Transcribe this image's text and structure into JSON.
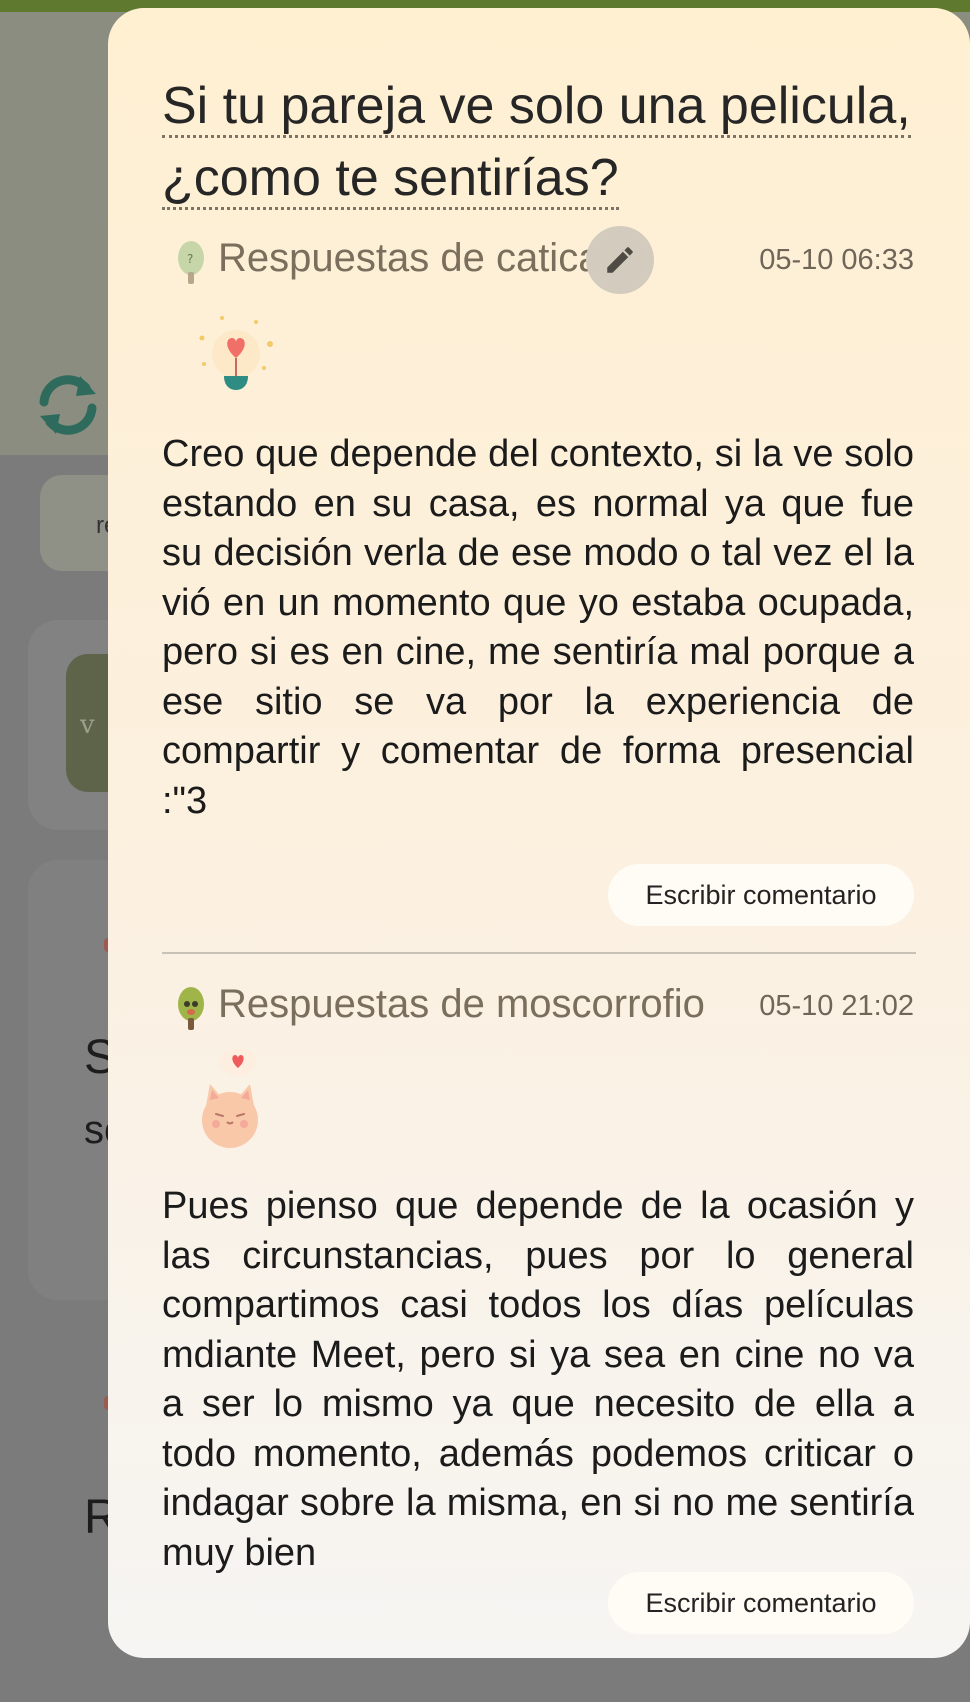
{
  "background": {
    "card_fragment": "re",
    "card_fragment2": "v",
    "letters": [
      "S",
      "so",
      "R"
    ]
  },
  "question": {
    "title_line1": "Si tu pareja ve solo una pelicula,",
    "title_line2": "¿como te sentirías?"
  },
  "answers": [
    {
      "author": "Respuestas de catica",
      "time": "05-10 06:33",
      "text": "Creo que depende del contexto, si la ve solo estando en su casa, es normal ya que fue su decisión verla de ese modo o tal vez el la vió en un momento que yo estaba ocupada, pero si es en cine, me sentiría mal porque a ese sitio se va por la experiencia de compartir y comentar de forma presencial :\"3",
      "comment_label": "Escribir comentario",
      "avatar_icon": "tree-avatar-icon",
      "emoji_icon": "lightbulb-heart-icon"
    },
    {
      "author": "Respuestas de moscorrofio",
      "time": "05-10 21:02",
      "text": "Pues pienso que depende de la ocasión y las circunstancias, pues por lo general compartimos casi todos los días películas mdiante Meet, pero si ya sea en cine no va a ser lo mismo ya que necesito de ella a todo momento, además podemos criticar o indagar sobre la misma, en si no me sentiría muy bien",
      "comment_label": "Escribir comentario",
      "avatar_icon": "tree-avatar-icon",
      "emoji_icon": "cat-heart-icon"
    }
  ],
  "colors": {
    "modal_top": "#fff0d2",
    "modal_bottom": "#f6f5f3",
    "accent_teal": "#2e7c6c"
  }
}
